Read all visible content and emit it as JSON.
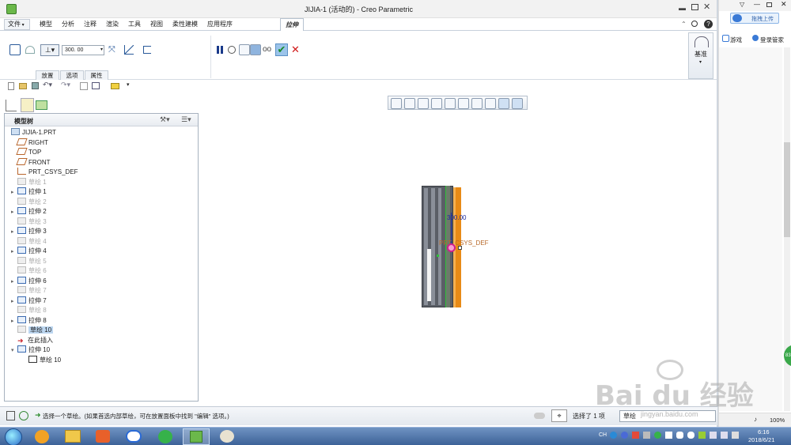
{
  "window": {
    "title": "JIJIA-1 (活动的) - Creo Parametric"
  },
  "menu": {
    "file": "文件",
    "tabs": [
      "模型",
      "分析",
      "注释",
      "渲染",
      "工具",
      "视图",
      "柔性建模",
      "应用程序"
    ],
    "active_tab": "拉伸"
  },
  "ribbon": {
    "depth_value": "300. 00",
    "subtabs": [
      "放置",
      "选项",
      "属性"
    ],
    "datum_label": "基准"
  },
  "tree": {
    "header": "模型树",
    "items": [
      {
        "label": "JIJIA-1.PRT",
        "state": "normal",
        "expand": false,
        "icon": "part"
      },
      {
        "label": "RIGHT",
        "state": "normal",
        "expand": false,
        "icon": "plane"
      },
      {
        "label": "TOP",
        "state": "normal",
        "expand": false,
        "icon": "plane"
      },
      {
        "label": "FRONT",
        "state": "normal",
        "expand": false,
        "icon": "plane"
      },
      {
        "label": "PRT_CSYS_DEF",
        "state": "normal",
        "expand": false,
        "icon": "csys"
      },
      {
        "label": "草绘 1",
        "state": "gray",
        "expand": false,
        "icon": "sketch"
      },
      {
        "label": "拉伸 1",
        "state": "normal",
        "expand": true,
        "icon": "extrude"
      },
      {
        "label": "草绘 2",
        "state": "gray",
        "expand": false,
        "icon": "sketch"
      },
      {
        "label": "拉伸 2",
        "state": "normal",
        "expand": true,
        "icon": "extrude"
      },
      {
        "label": "草绘 3",
        "state": "gray",
        "expand": false,
        "icon": "sketch"
      },
      {
        "label": "拉伸 3",
        "state": "normal",
        "expand": true,
        "icon": "extrude"
      },
      {
        "label": "草绘 4",
        "state": "gray",
        "expand": false,
        "icon": "sketch"
      },
      {
        "label": "拉伸 4",
        "state": "normal",
        "expand": true,
        "icon": "extrude"
      },
      {
        "label": "草绘 5",
        "state": "gray",
        "expand": false,
        "icon": "sketch"
      },
      {
        "label": "草绘 6",
        "state": "gray",
        "expand": false,
        "icon": "sketch"
      },
      {
        "label": "拉伸 6",
        "state": "normal",
        "expand": true,
        "icon": "extrude"
      },
      {
        "label": "草绘 7",
        "state": "gray",
        "expand": false,
        "icon": "sketch"
      },
      {
        "label": "拉伸 7",
        "state": "normal",
        "expand": true,
        "icon": "extrude"
      },
      {
        "label": "草绘 8",
        "state": "gray",
        "expand": false,
        "icon": "sketch"
      },
      {
        "label": "拉伸 8",
        "state": "normal",
        "expand": true,
        "icon": "extrude"
      },
      {
        "label": "草绘 10",
        "state": "selected",
        "expand": false,
        "icon": "sketch"
      },
      {
        "label": "在此插入",
        "state": "insert",
        "expand": false,
        "icon": "insert"
      },
      {
        "label": "拉伸 10",
        "state": "normal",
        "expand": "open",
        "icon": "extrude"
      },
      {
        "label": "草绘 10",
        "state": "child",
        "expand": false,
        "icon": "sketch-edit"
      }
    ]
  },
  "viewport": {
    "dimension_label": "300.00",
    "csys_label": "PRT_CSYS_DEF"
  },
  "status": {
    "message": "选择一个草绘。(如果首选内部草绘，可在放置面板中找到 \"编辑\" 选项。)",
    "selected_count": "选择了 1 项",
    "filter": "草绘"
  },
  "side_panel": {
    "upload": "拖拽上传",
    "games": "游戏",
    "login": "登录管家",
    "zoom": "100%"
  },
  "taskbar": {
    "time": "6:16",
    "date": "2018/6/21",
    "lang": "CH"
  },
  "watermark": {
    "text": "Bai du 经验",
    "url": "jingyan.baidu.com"
  },
  "colors": {
    "accent_orange": "#e88a16",
    "selection_magenta": "#d0208c",
    "dimension_blue": "#1a2aa0"
  }
}
